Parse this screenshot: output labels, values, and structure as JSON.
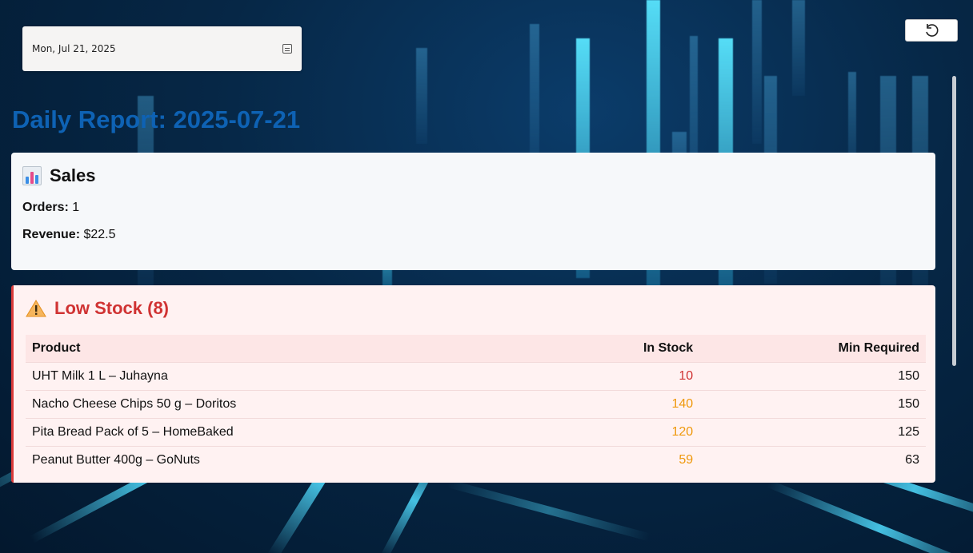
{
  "date_picker": {
    "value": "Mon, Jul 21, 2025",
    "icon": "calendar-icon"
  },
  "reset_button": {
    "icon": "undo-icon"
  },
  "report": {
    "title": "Daily Report: 2025-07-21"
  },
  "sales": {
    "title": "Sales",
    "icon": "bar-chart-icon",
    "orders_label": "Orders:",
    "orders_value": "1",
    "revenue_label": "Revenue:",
    "revenue_value": "$22.5"
  },
  "low_stock": {
    "title": "Low Stock (8)",
    "icon": "warning-icon",
    "columns": [
      "Product",
      "In Stock",
      "Min Required"
    ],
    "rows": [
      {
        "product": "UHT Milk 1 L – Juhayna",
        "in_stock": "10",
        "min_required": "150",
        "severity": "red"
      },
      {
        "product": "Nacho Cheese Chips 50 g – Doritos",
        "in_stock": "140",
        "min_required": "150",
        "severity": "orange"
      },
      {
        "product": "Pita Bread Pack of 5 – HomeBaked",
        "in_stock": "120",
        "min_required": "125",
        "severity": "orange"
      },
      {
        "product": "Peanut Butter 400g – GoNuts",
        "in_stock": "59",
        "min_required": "63",
        "severity": "orange"
      }
    ]
  },
  "colors": {
    "title_blue": "#0e62b4",
    "danger_red": "#d03333",
    "warning_orange": "#ef9a0f"
  }
}
